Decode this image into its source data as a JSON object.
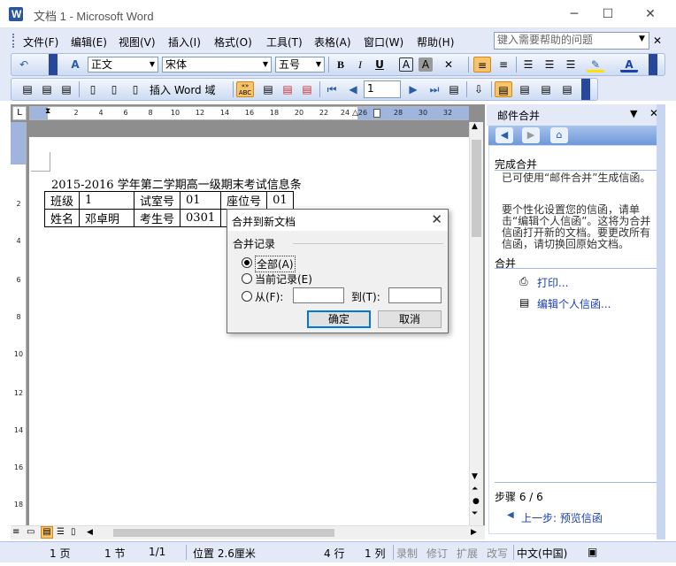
{
  "window": {
    "title": "文档 1 - Microsoft Word",
    "minimize": "─",
    "maximize": "☐",
    "close": "✕"
  },
  "menubar": {
    "items": [
      "文件(F)",
      "编辑(E)",
      "视图(V)",
      "插入(I)",
      "格式(O)",
      "工具(T)",
      "表格(A)",
      "窗口(W)",
      "帮助(H)"
    ],
    "help_search_placeholder": "键入需要帮助的问题"
  },
  "format_toolbar": {
    "style": "正文",
    "font": "宋体",
    "size": "五号",
    "bold": "B",
    "italic": "I",
    "underline": "U",
    "char_border": "A",
    "char_shading": "A",
    "font_color": "A"
  },
  "mailmerge_toolbar": {
    "insert_word_field": "插入 Word 域",
    "record_number": "1"
  },
  "ruler": {
    "ticks": [
      "2",
      "4",
      "6",
      "8",
      "10",
      "12",
      "14",
      "16",
      "18",
      "20",
      "22",
      "24",
      "26",
      "28",
      "30",
      "32"
    ],
    "vticks": [
      "2",
      "4",
      "6",
      "8",
      "10",
      "12",
      "14",
      "16",
      "18"
    ]
  },
  "document": {
    "heading": "2015-2016 学年第二学期高一级期末考试信息条",
    "rows": [
      [
        "班级",
        "1",
        "试室号",
        "01",
        "座位号",
        "01"
      ],
      [
        "姓名",
        "邓卓明",
        "考生号",
        "0301",
        "",
        ""
      ]
    ]
  },
  "dialog": {
    "title": "合并到新文档",
    "close": "✕",
    "group_label": "合并记录",
    "option_all": "全部(A)",
    "option_current": "当前记录(E)",
    "option_from": "从(F):",
    "to_label": "到(T):",
    "ok": "确定",
    "cancel": "取消"
  },
  "taskpane": {
    "title": "邮件合并",
    "close": "✕",
    "section_complete": "完成合并",
    "text1": "已可使用“邮件合并”生成信函。",
    "text2": "要个性化设置您的信函，请单击“编辑个人信函”。这将为合并信函打开新的文档。要更改所有信函，请切换回原始文档。",
    "section_merge": "合并",
    "link_print": "打印...",
    "link_edit": "编辑个人信函...",
    "step": "步骤 6 / 6",
    "prev_step": "上一步: 预览信函"
  },
  "statusbar": {
    "page": "1 页",
    "section": "1 节",
    "pages": "1/1",
    "position": "位置 2.6厘米",
    "line": "4 行",
    "column": "1 列",
    "rec": "录制",
    "trk": "修订",
    "ext": "扩展",
    "ovr": "改写",
    "lang": "中文(中国)"
  },
  "colors": {
    "chrome": "#e3e9f7",
    "dialog_ok_border": "#0078d7",
    "link": "#1a3fb0",
    "doc_background": "#8e8e8e"
  }
}
